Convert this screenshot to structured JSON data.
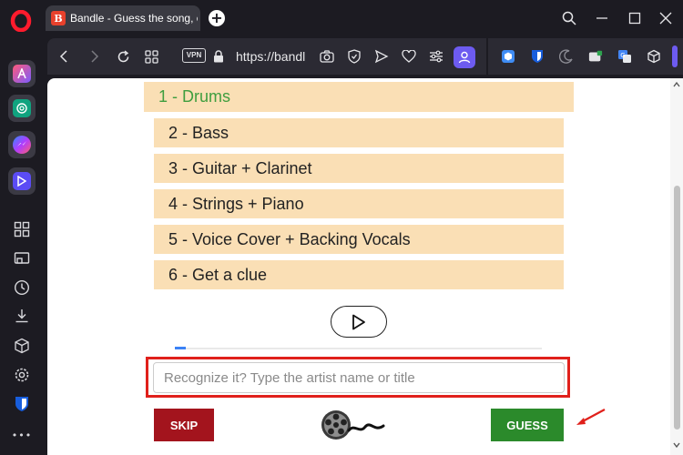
{
  "browser": {
    "tab": {
      "favicon_letter": "B",
      "title": "Bandle - Guess the song, c"
    },
    "newtab_label": "+",
    "address": {
      "vpn_label": "VPN",
      "url": "https://bandl"
    }
  },
  "sidebar": {
    "apps": [
      "aria-icon",
      "chatgpt-icon",
      "messenger-icon",
      "player-icon"
    ],
    "tools": [
      "workspaces-icon",
      "tabs-icon",
      "history-icon",
      "downloads-icon",
      "extensions-icon",
      "settings-icon",
      "bitwarden-icon",
      "more-icon"
    ],
    "more_label": "•••"
  },
  "game": {
    "stages": [
      {
        "label": "1 - Drums",
        "current": true
      },
      {
        "label": "2 - Bass",
        "current": false
      },
      {
        "label": "3 - Guitar + Clarinet",
        "current": false
      },
      {
        "label": "4 - Strings + Piano",
        "current": false
      },
      {
        "label": "5 - Voice Cover + Backing Vocals",
        "current": false
      },
      {
        "label": "6 - Get a clue",
        "current": false
      }
    ],
    "progress_fraction": 0.03,
    "guess_placeholder": "Recognize it? Type the artist name or title",
    "guess_value": "",
    "skip_label": "SKIP",
    "guess_label": "GUESS"
  },
  "colors": {
    "current_stage_text": "#3f9e3f",
    "stage_bg": "#fadfb5",
    "skip_bg": "#a3141d",
    "guess_bg": "#2b8a2b",
    "highlight_frame": "#e0201b",
    "browser_bg": "#1c1b22"
  }
}
